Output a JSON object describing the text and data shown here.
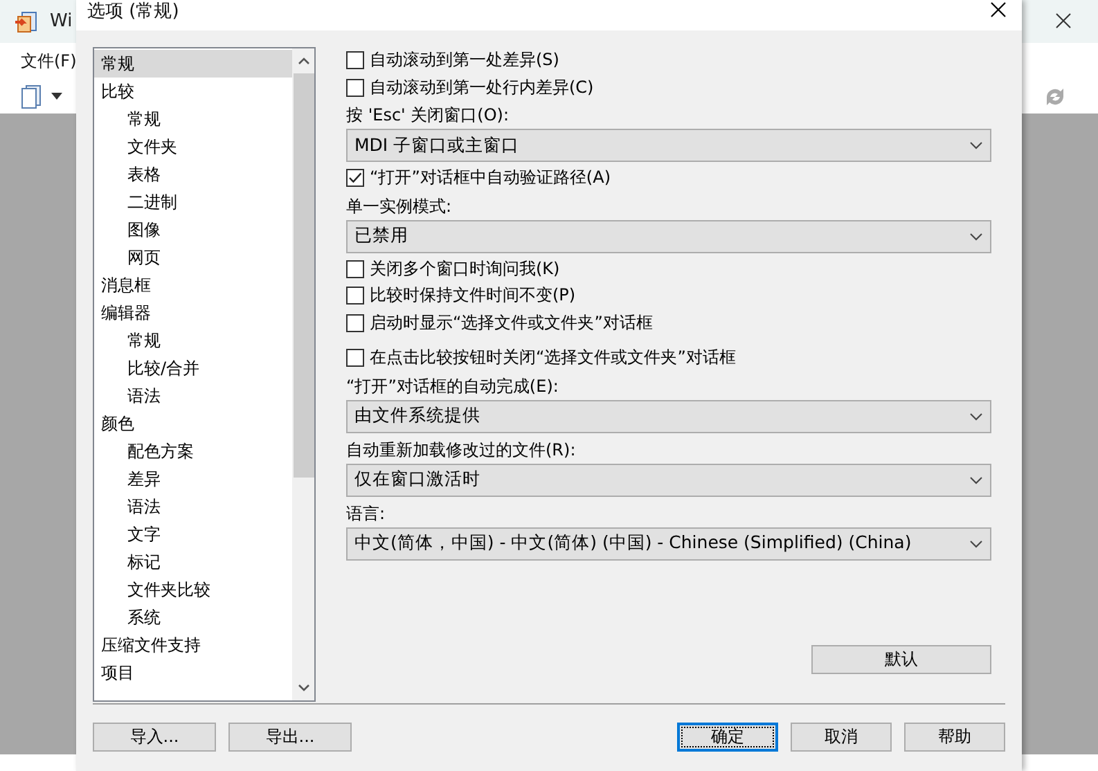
{
  "app_window": {
    "title": "Wi",
    "menu": [
      "文件(F)"
    ]
  },
  "dialog": {
    "title": "选项 (常规)",
    "tree": [
      {
        "label": "常规",
        "selected": true
      },
      {
        "label": "比较",
        "selected": false,
        "children": [
          {
            "label": "常规",
            "selected": false
          },
          {
            "label": "文件夹",
            "selected": false
          },
          {
            "label": "表格",
            "selected": false
          },
          {
            "label": "二进制",
            "selected": false
          },
          {
            "label": "图像",
            "selected": false
          },
          {
            "label": "网页",
            "selected": false
          }
        ]
      },
      {
        "label": "消息框",
        "selected": false
      },
      {
        "label": "编辑器",
        "selected": false,
        "children": [
          {
            "label": "常规",
            "selected": false
          },
          {
            "label": "比较/合并",
            "selected": false
          },
          {
            "label": "语法",
            "selected": false
          }
        ]
      },
      {
        "label": "颜色",
        "selected": false,
        "children": [
          {
            "label": "配色方案",
            "selected": false
          },
          {
            "label": "差异",
            "selected": false
          },
          {
            "label": "语法",
            "selected": false
          },
          {
            "label": "文字",
            "selected": false
          },
          {
            "label": "标记",
            "selected": false
          },
          {
            "label": "文件夹比较",
            "selected": false
          },
          {
            "label": "系统",
            "selected": false
          }
        ]
      },
      {
        "label": "压缩文件支持",
        "selected": false
      },
      {
        "label": "项目",
        "selected": false
      }
    ],
    "options": [
      {
        "kind": "checkbox",
        "label": "自动滚动到第一处差异(S)",
        "checked": false
      },
      {
        "kind": "checkbox",
        "label": "自动滚动到第一处行内差异(C)",
        "checked": false
      },
      {
        "kind": "label",
        "label": "按 'Esc' 关闭窗口(O):"
      },
      {
        "kind": "select",
        "value": "MDI 子窗口或主窗口"
      },
      {
        "kind": "checkbox",
        "label": "“打开”对话框中自动验证路径(A)",
        "checked": true
      },
      {
        "kind": "label",
        "label": "单一实例模式:"
      },
      {
        "kind": "select",
        "value": "已禁用"
      },
      {
        "kind": "checkbox",
        "label": "关闭多个窗口时询问我(K)",
        "checked": false
      },
      {
        "kind": "checkbox",
        "label": "比较时保持文件时间不变(P)",
        "checked": false
      },
      {
        "kind": "checkbox",
        "label": "启动时显示“选择文件或文件夹”对话框",
        "checked": false
      },
      {
        "kind": "checkbox",
        "label": "在点击比较按钮时关闭“选择文件或文件夹”对话框",
        "checked": false
      },
      {
        "kind": "label",
        "label": "“打开”对话框的自动完成(E):"
      },
      {
        "kind": "select",
        "value": "由文件系统提供"
      },
      {
        "kind": "label",
        "label": "自动重新加载修改过的文件(R):"
      },
      {
        "kind": "select",
        "value": "仅在窗口激活时"
      },
      {
        "kind": "label",
        "label": "语言:"
      },
      {
        "kind": "select",
        "value": "中文(简体，中国) - 中文(简体) (中国) - Chinese (Simplified) (China)"
      }
    ],
    "default_button": "默认",
    "left_buttons": [
      "导入...",
      "导出..."
    ],
    "buttons": [
      {
        "label": "确定",
        "focused": true
      },
      {
        "label": "取消",
        "focused": false
      },
      {
        "label": "帮助",
        "focused": false
      }
    ]
  }
}
